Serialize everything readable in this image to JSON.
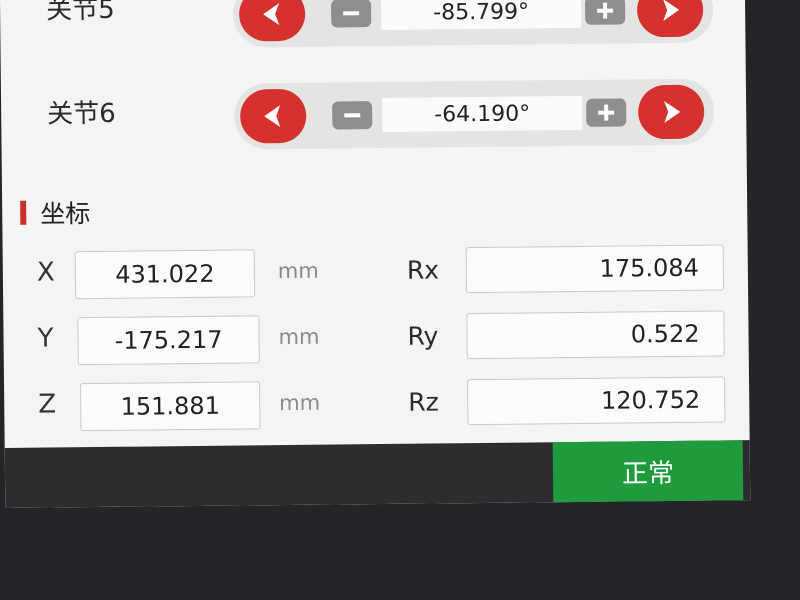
{
  "joints": [
    {
      "label": "关节5",
      "value": "-85.799°"
    },
    {
      "label": "关节6",
      "value": "-64.190°"
    }
  ],
  "coordinates": {
    "section_title": "坐标",
    "unit": "mm",
    "rows": [
      {
        "axis": "X",
        "value": "431.022",
        "rot_label": "Rx",
        "rot_value": "175.084"
      },
      {
        "axis": "Y",
        "value": "-175.217",
        "rot_label": "Ry",
        "rot_value": "0.522"
      },
      {
        "axis": "Z",
        "value": "151.881",
        "rot_label": "Rz",
        "rot_value": "120.752"
      }
    ]
  },
  "status": {
    "label": "正常"
  },
  "colors": {
    "accent_red": "#d5312f",
    "status_green": "#1f9a3d",
    "step_gray": "#8e8e8c"
  },
  "icons": {
    "decrease_fast": "chevron-left-icon",
    "decrease": "minus-icon",
    "increase": "plus-icon",
    "increase_fast": "chevron-right-icon"
  }
}
